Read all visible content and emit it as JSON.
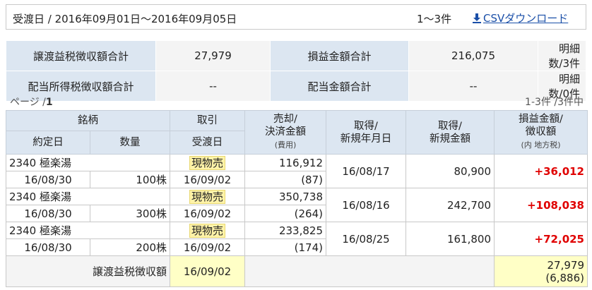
{
  "header": {
    "period": "受渡日 / 2016年09月01日〜2016年09月05日",
    "count": "1〜3件",
    "csv_label": "CSVダウンロード"
  },
  "summary": {
    "row1": [
      {
        "label": "譲渡益税徴収額合計",
        "value": "27,979"
      },
      {
        "label": "損益金額合計",
        "value": "216,075"
      },
      {
        "value": "明細数/3件"
      }
    ],
    "row2": [
      {
        "label": "配当所得税徴収額合計",
        "value": "--"
      },
      {
        "label": "配当金額合計",
        "value": "--"
      },
      {
        "value": "明細数/0件"
      }
    ]
  },
  "pager": {
    "prefix": "ページ /",
    "page": "1",
    "count": "1-3件 /3件中"
  },
  "table": {
    "h": {
      "brand": "銘柄",
      "trade": "取引",
      "settle": "売却/",
      "settle2": "決済金額",
      "settle_sub": "(費用)",
      "acq_date": "取得/",
      "acq_date2": "新規年月日",
      "acq_amt": "取得/",
      "acq_amt2": "新規金額",
      "pl": "損益金額/",
      "pl2": "徴収額",
      "pl_sub": "(内 地方税)",
      "contract": "約定日",
      "qty": "数量",
      "delivery": "受渡日"
    },
    "rows": [
      {
        "brand": "2340 極楽湯",
        "trade": "現物売",
        "amount": "116,912",
        "contract": "16/08/30",
        "qty": "100株",
        "delivery": "16/09/02",
        "fee": "(87)",
        "acq_date": "16/08/17",
        "acq_amt": "80,900",
        "pl": "+36,012"
      },
      {
        "brand": "2340 極楽湯",
        "trade": "現物売",
        "amount": "350,738",
        "contract": "16/08/30",
        "qty": "300株",
        "delivery": "16/09/02",
        "fee": "(264)",
        "acq_date": "16/08/16",
        "acq_amt": "242,700",
        "pl": "+108,038"
      },
      {
        "brand": "2340 極楽湯",
        "trade": "現物売",
        "amount": "233,825",
        "contract": "16/08/30",
        "qty": "200株",
        "delivery": "16/09/02",
        "fee": "(174)",
        "acq_date": "16/08/25",
        "acq_amt": "161,800",
        "pl": "+72,025"
      }
    ],
    "total": {
      "label": "譲渡益税徴収額",
      "date": "16/09/02",
      "value": "27,979",
      "sub": "(6,886)"
    }
  },
  "colors": {
    "header_bg": "#dce6f1",
    "gain": "#e00000",
    "link": "#1a4fa8",
    "highlight": "#ffffc6"
  }
}
